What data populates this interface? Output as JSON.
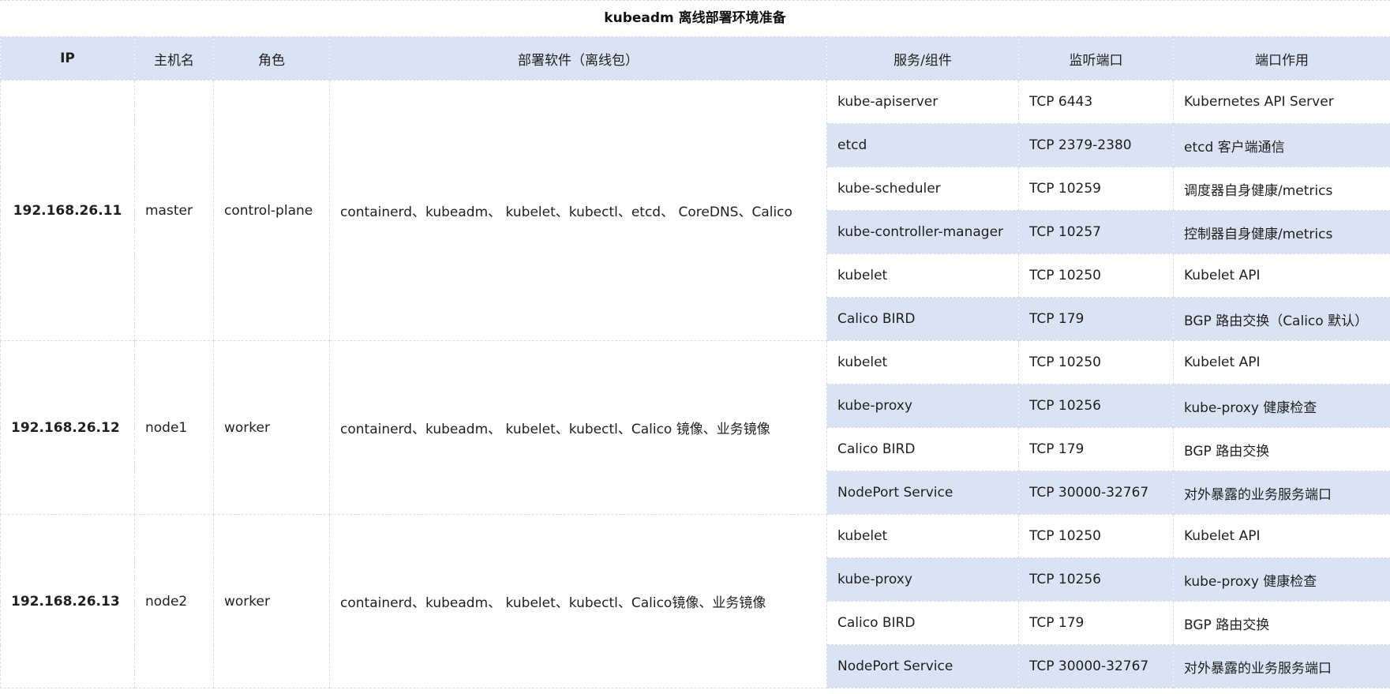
{
  "title": "kubeadm 离线部署环境准备",
  "headers": {
    "ip": "IP",
    "host": "主机名",
    "role": "角色",
    "software": "部署软件（离线包）",
    "service": "服务/组件",
    "port": "监听端口",
    "usage": "端口作用"
  },
  "hosts": [
    {
      "ip": "192.168.26.11",
      "hostname": "master",
      "role": "control-plane",
      "software": "containerd、kubeadm、 kubelet、kubectl、etcd、 CoreDNS、Calico",
      "services": [
        {
          "service": "kube-apiserver",
          "port": "TCP 6443",
          "usage": "Kubernetes API Server"
        },
        {
          "service": "etcd",
          "port": "TCP 2379-2380",
          "usage": "etcd 客户端通信"
        },
        {
          "service": "kube-scheduler",
          "port": "TCP 10259",
          "usage": "调度器自身健康/metrics"
        },
        {
          "service": "kube-controller-manager",
          "port": "TCP 10257",
          "usage": "控制器自身健康/metrics"
        },
        {
          "service": "kubelet",
          "port": "TCP 10250",
          "usage": "Kubelet API"
        },
        {
          "service": "Calico BIRD",
          "port": "TCP 179",
          "usage": "BGP 路由交换（Calico 默认）"
        }
      ]
    },
    {
      "ip": "192.168.26.12",
      "hostname": "node1",
      "role": "worker",
      "software": "containerd、kubeadm、 kubelet、kubectl、Calico 镜像、业务镜像",
      "services": [
        {
          "service": "kubelet",
          "port": "TCP 10250",
          "usage": "Kubelet API"
        },
        {
          "service": "kube-proxy",
          "port": "TCP 10256",
          "usage": "kube-proxy 健康检查"
        },
        {
          "service": "Calico BIRD",
          "port": "TCP 179",
          "usage": "BGP 路由交换"
        },
        {
          "service": "NodePort Service",
          "port": "TCP 30000-32767",
          "usage": "对外暴露的业务服务端口"
        }
      ]
    },
    {
      "ip": "192.168.26.13",
      "hostname": "node2",
      "role": "worker",
      "software": "containerd、kubeadm、 kubelet、kubectl、Calico镜像、业务镜像",
      "services": [
        {
          "service": "kubelet",
          "port": "TCP 10250",
          "usage": "Kubelet API"
        },
        {
          "service": "kube-proxy",
          "port": "TCP 10256",
          "usage": "kube-proxy 健康检查"
        },
        {
          "service": "Calico BIRD",
          "port": "TCP 179",
          "usage": "BGP 路由交换"
        },
        {
          "service": "NodePort Service",
          "port": "TCP 30000-32767",
          "usage": "对外暴露的业务服务端口"
        }
      ]
    }
  ]
}
